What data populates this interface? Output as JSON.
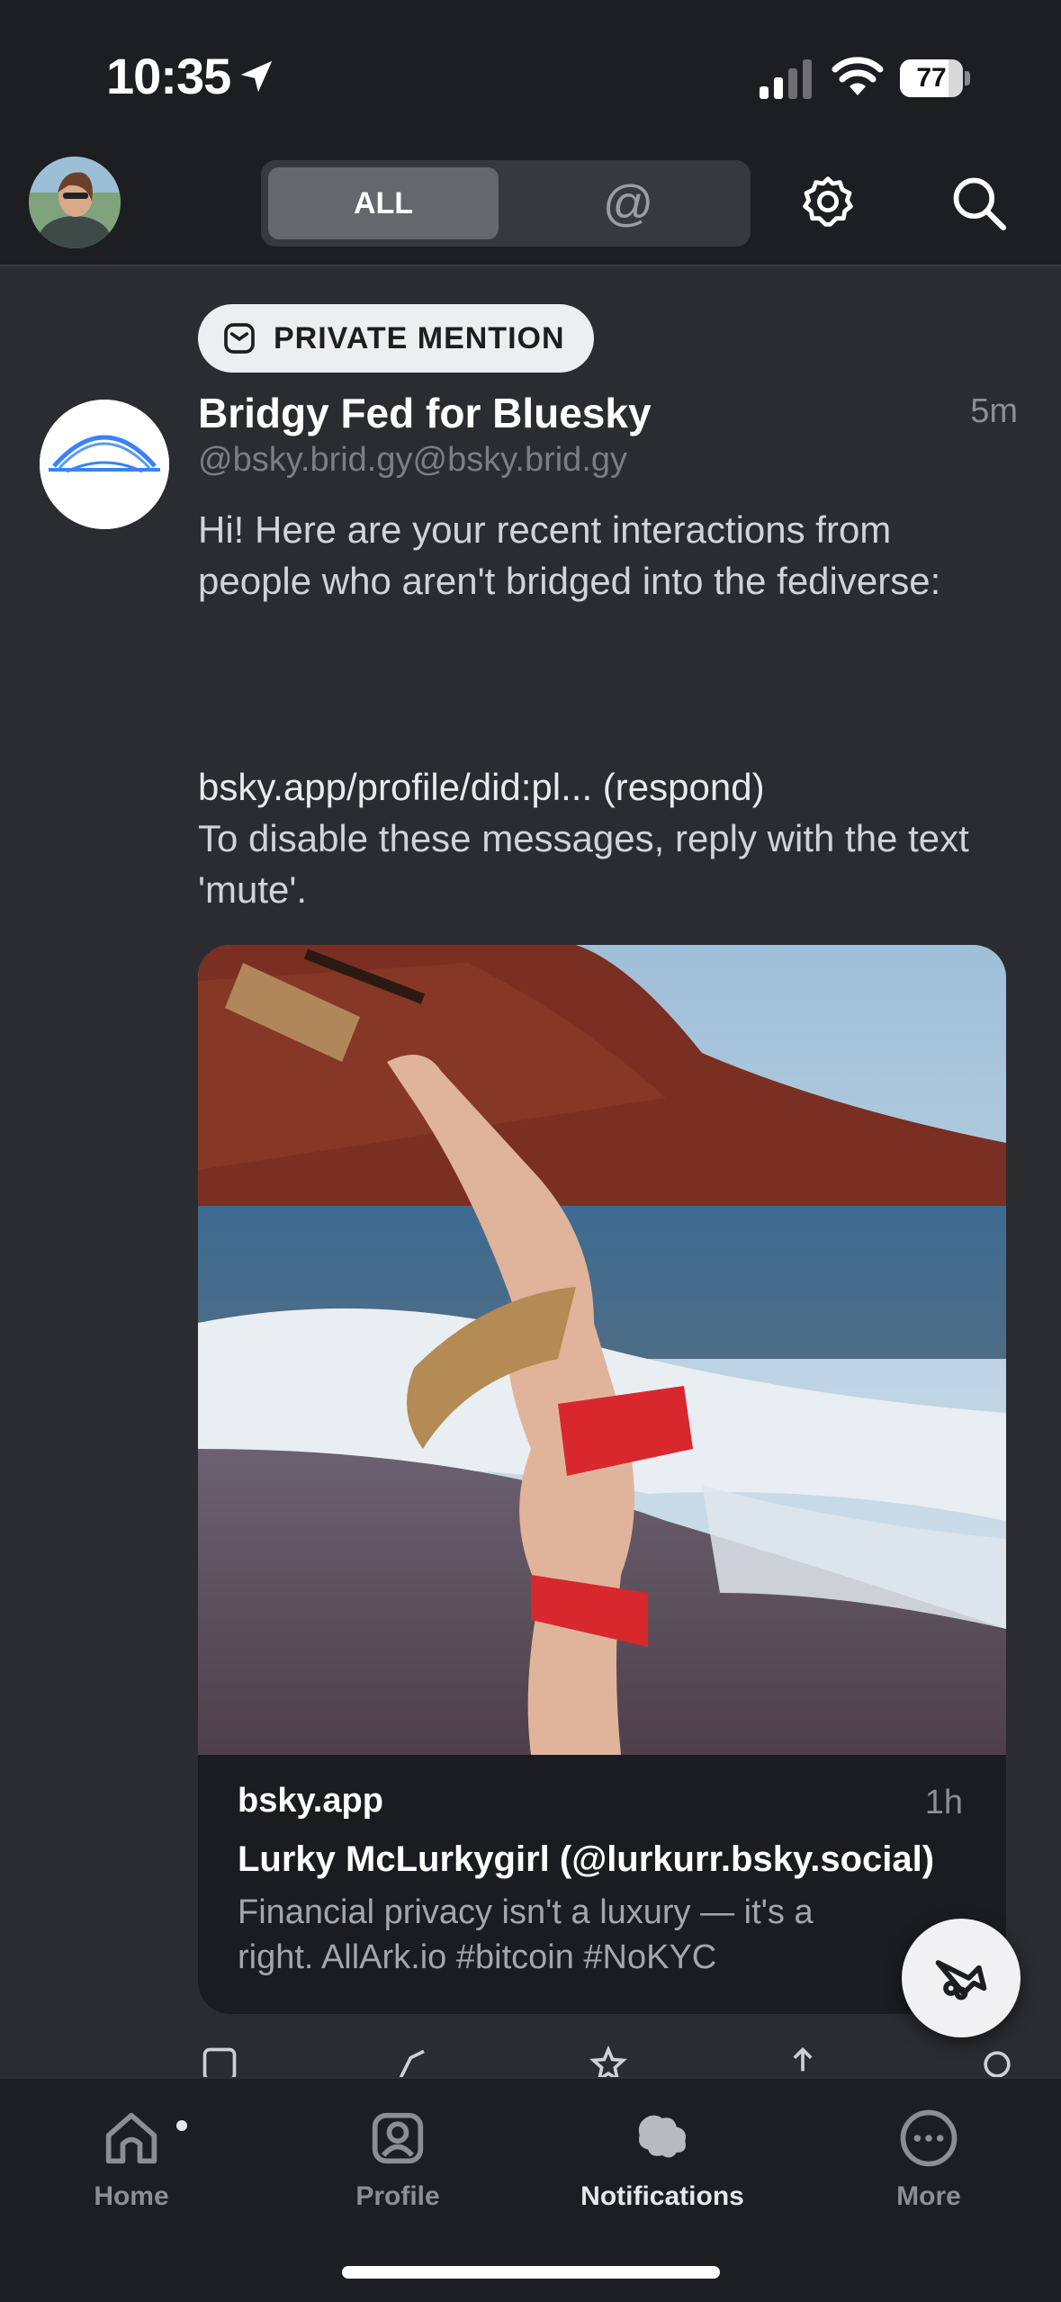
{
  "status_bar": {
    "time": "10:35",
    "battery": "77",
    "battery_level": 0.77
  },
  "header": {
    "tab_all": "ALL",
    "tab_mentions": "@"
  },
  "post": {
    "badge": "PRIVATE MENTION",
    "author": "Bridgy Fed for Bluesky",
    "handle": "@bsky.brid.gy@bsky.brid.gy",
    "time": "5m",
    "text_intro": "Hi! Here are your recent interactions from people who aren't bridged into the fediverse:",
    "link_text": "bsky.app/profile/did:pl... (respond)",
    "text_footer": "To disable these messages, reply with the text 'mute'."
  },
  "card": {
    "domain": "bsky.app",
    "time": "1h",
    "title": "Lurky McLurkygirl (@lurkurr.bsky.social)",
    "description": "Financial privacy isn't a luxury — it's a right. AllArk.io #bitcoin #NoKYC"
  },
  "tabs": [
    {
      "label": "Home",
      "icon": "home-icon"
    },
    {
      "label": "Profile",
      "icon": "profile-icon"
    },
    {
      "label": "Notifications",
      "icon": "notifications-icon"
    },
    {
      "label": "More",
      "icon": "more-icon"
    }
  ],
  "colors": {
    "background": "#2b2c30",
    "bar": "#1d1e21",
    "accent_blue": "#3b82f6"
  }
}
